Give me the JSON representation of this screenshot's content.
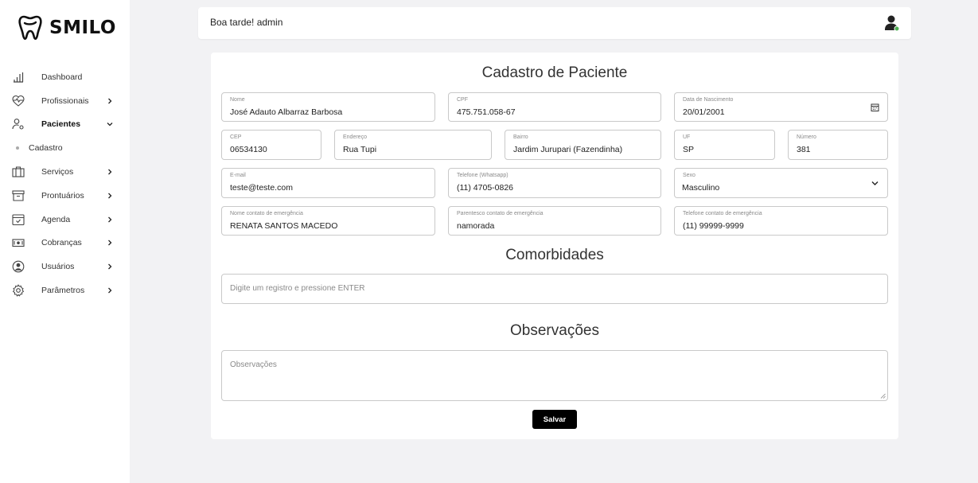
{
  "brand": {
    "name": "SMILO"
  },
  "sidebar": {
    "items": [
      {
        "label": "Dashboard",
        "icon": "bar-chart-icon",
        "chevron": false,
        "active": false
      },
      {
        "label": "Profissionais",
        "icon": "heart-pulse-icon",
        "chevron": "right",
        "active": false
      },
      {
        "label": "Pacientes",
        "icon": "user-settings-icon",
        "chevron": "down",
        "active": true
      },
      {
        "label": "Serviços",
        "icon": "briefcase-icon",
        "chevron": "right",
        "active": false
      },
      {
        "label": "Prontuários",
        "icon": "archive-icon",
        "chevron": "right",
        "active": false
      },
      {
        "label": "Agenda",
        "icon": "calendar-check-icon",
        "chevron": "right",
        "active": false
      },
      {
        "label": "Cobranças",
        "icon": "cash-icon",
        "chevron": "right",
        "active": false
      },
      {
        "label": "Usuários",
        "icon": "user-circle-icon",
        "chevron": "right",
        "active": false
      },
      {
        "label": "Parâmetros",
        "icon": "gear-icon",
        "chevron": "right",
        "active": false
      }
    ],
    "subitem": {
      "label": "Cadastro"
    }
  },
  "topbar": {
    "greeting": "Boa tarde! admin"
  },
  "form": {
    "title": "Cadastro de Paciente",
    "fields": {
      "nome": {
        "label": "Nome",
        "value": "José Adauto Albarraz Barbosa"
      },
      "cpf": {
        "label": "CPF",
        "value": "475.751.058-67"
      },
      "nascimento": {
        "label": "Data de Nascimento",
        "value": "20/01/2001"
      },
      "cep": {
        "label": "CEP",
        "value": "06534130"
      },
      "endereco": {
        "label": "Endereço",
        "value": "Rua Tupi"
      },
      "bairro": {
        "label": "Bairro",
        "value": "Jardim Jurupari (Fazendinha)"
      },
      "uf": {
        "label": "UF",
        "value": "SP"
      },
      "numero": {
        "label": "Número",
        "value": "381"
      },
      "email": {
        "label": "E-mail",
        "value": "teste@teste.com"
      },
      "telefone": {
        "label": "Telefone (Whatsapp)",
        "value": "(11) 4705-0826"
      },
      "sexo": {
        "label": "Sexo",
        "value": "Masculino"
      },
      "contato_nome": {
        "label": "Nome contato de emergência",
        "value": "RENATA SANTOS MACEDO"
      },
      "contato_parentesco": {
        "label": "Parentesco contato de emergência",
        "value": "namorada"
      },
      "contato_telefone": {
        "label": "Telefone contato de emergência",
        "value": "(11) 99999-9999"
      }
    },
    "comorbidades": {
      "title": "Comorbidades",
      "placeholder": "Digite um registro e pressione ENTER"
    },
    "observacoes": {
      "title": "Observações",
      "placeholder": "Observações"
    },
    "save_label": "Salvar"
  },
  "colors": {
    "background": "#f2f2f4",
    "button": "#000000",
    "status_online": "#4caf50"
  }
}
